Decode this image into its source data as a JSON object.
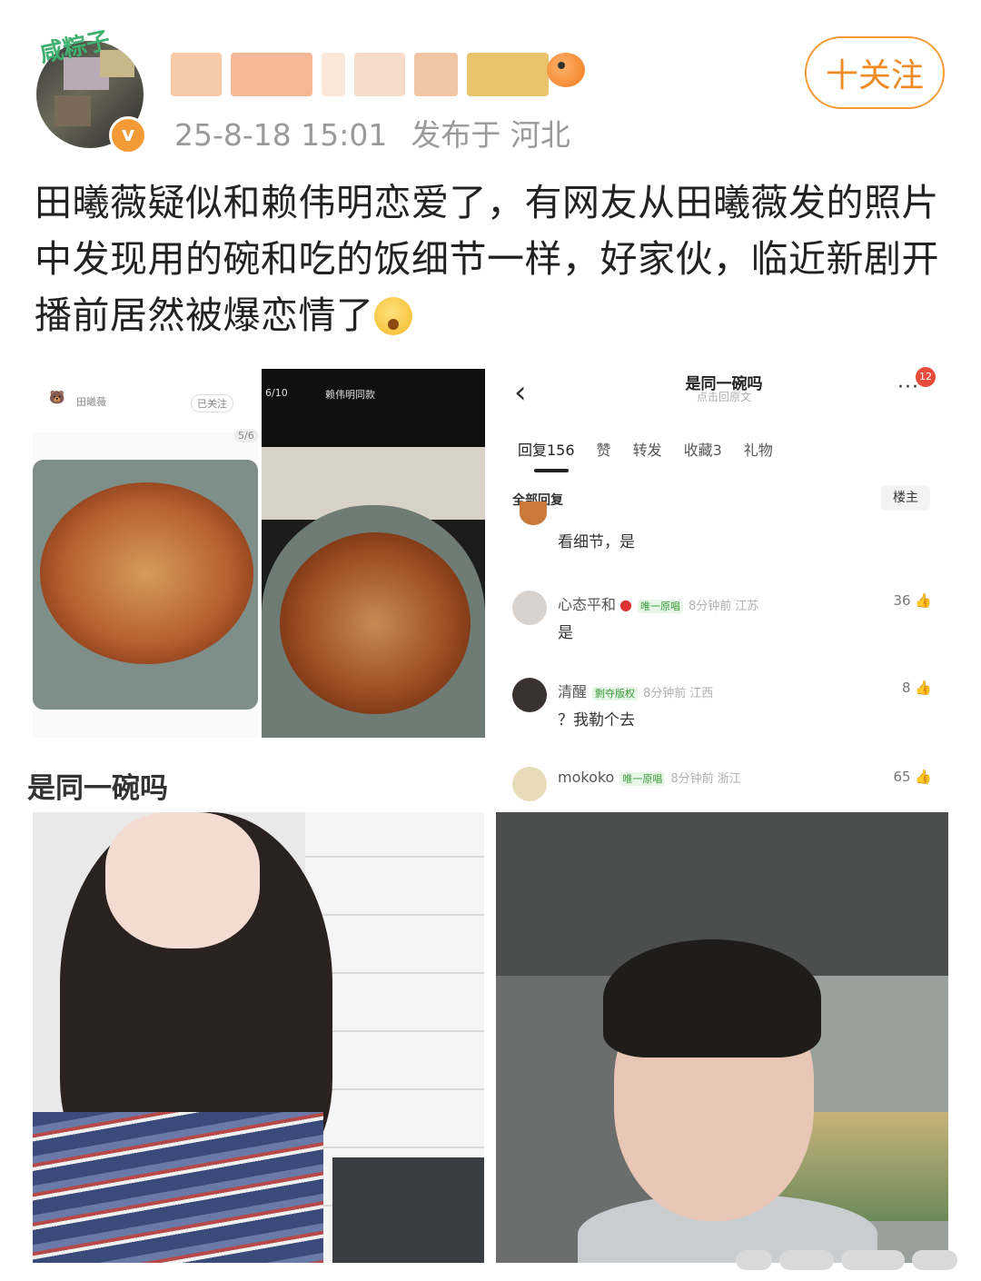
{
  "post": {
    "avatar_tag": "咸粽子",
    "verified_mark": "v",
    "date": "25-8-18 15:01",
    "location": "发布于 河北",
    "follow_label": "十关注",
    "text": "田曦薇疑似和赖伟明恋爱了，有网友从田曦薇发的照片中发现用的碗和吃的饭细节一样，好家伙，临近新剧开播前居然被爆恋情了"
  },
  "images": {
    "food_left": {
      "name": "田曦薇",
      "followed": "已关注",
      "counter": "5/6"
    },
    "food_right": {
      "page": "6/10",
      "name": "赖伟明同款"
    }
  },
  "comments_screenshot": {
    "title": "是同一碗吗",
    "subtitle": "点击回原文",
    "more_badge": "12",
    "tabs": [
      "回复156",
      "赞",
      "转发",
      "收藏3",
      "礼物"
    ],
    "all_replies": "全部回复",
    "op_label": "楼主",
    "comments": [
      {
        "name": "",
        "badge": "",
        "time": "",
        "location": "",
        "likes": "",
        "body": "看细节，是"
      },
      {
        "name": "心态平和",
        "badge": "唯一原唱",
        "time": "8分钟前",
        "location": "江苏",
        "likes": "36",
        "body": "是"
      },
      {
        "name": "清醒",
        "badge": "剽夺版权",
        "time": "8分钟前",
        "location": "江西",
        "likes": "8",
        "body": "？我勒个去"
      },
      {
        "name": "mokoko",
        "badge": "唯一原唱",
        "time": "8分钟前",
        "location": "浙江",
        "likes": "65",
        "body": ""
      }
    ]
  },
  "section_heading": "是同一碗吗",
  "colors": {
    "accent": "#f29a36",
    "follow_text": "#f08a24",
    "meta_text": "#9a9a9a",
    "badge_green": "#5fb85f",
    "badge_red": "#e84a3a"
  },
  "icons": [
    "verified-icon",
    "fish-emoji-icon",
    "shock-emoji-icon",
    "back-arrow-icon",
    "more-icon",
    "thumbs-up-icon",
    "apple-emoji-icon"
  ]
}
